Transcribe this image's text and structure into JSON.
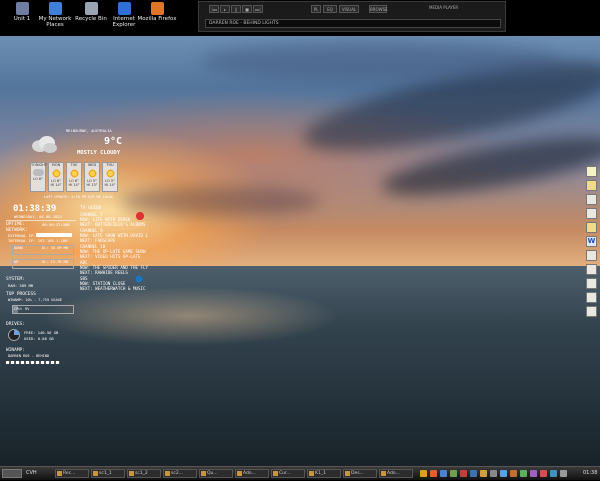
{
  "desktop_icons": [
    {
      "label": "Unit 1",
      "icon": "drive-icon",
      "color": "#6f7ea0"
    },
    {
      "label": "My Network Places",
      "icon": "network-places-icon",
      "color": "#3f7fd8"
    },
    {
      "label": "Recycle Bin",
      "icon": "recycle-bin-icon",
      "color": "#9aa4b2"
    },
    {
      "label": "Internet Explorer",
      "icon": "internet-explorer-icon",
      "color": "#2f6fd8"
    },
    {
      "label": "Mozilla Firefox",
      "icon": "firefox-icon",
      "color": "#e0752a"
    }
  ],
  "media_player": {
    "now_playing": "DARREN ROE - BEHIND LIGHTS",
    "buttons": [
      "|◂◂",
      "▸",
      "||",
      "■",
      "▸▸|",
      "PL",
      "EQ",
      "VISUAL",
      "BROWSE"
    ],
    "mode": "MEDIA PLAYER"
  },
  "weather": {
    "location": "MELBOURNE, AUSTRALIA",
    "temperature": "9°C",
    "condition": "MOSTLY CLOUDY",
    "updated": "LAST UPDATE: 5:59 PM   USE ME LOCAL",
    "forecast": [
      {
        "day": "TONIGHT",
        "low": "LO 8°",
        "high": "",
        "icon": "cloud-icon"
      },
      {
        "day": "MON",
        "low": "LO 6°",
        "high": "HI 14°",
        "icon": "sun-icon"
      },
      {
        "day": "TUE",
        "low": "LO 6°",
        "high": "HI 14°",
        "icon": "sun-icon"
      },
      {
        "day": "WED",
        "low": "LO 5°",
        "high": "HI 13°",
        "icon": "sun-icon"
      },
      {
        "day": "THU",
        "low": "LO 5°",
        "high": "HI 14°",
        "icon": "sun-icon"
      }
    ]
  },
  "system": {
    "clock": "01:38:39",
    "date": "WEDNESDAY, 04.08.2021",
    "uptime_label": "UPTIME:",
    "uptime": "00:5H:17:40M",
    "network_label": "NETWORK:",
    "ext_ip": "EXTERNAL IP:",
    "int_ip": "INTERNAL IP: 192.168.1.100",
    "down": "DOWN",
    "down_total": "DL: 38.5M MB",
    "up": "UP",
    "up_total": "UL: 15.7M MB",
    "sys_label": "SYSTEM:",
    "ram": "RAM: 389 MB",
    "top_process": "TOP PROCESS",
    "winamp": "WINAMP: 10% - 7,755 USAGE",
    "cpu": "CPU: 9%",
    "drives_label": "DRIVES:",
    "free": "FREE: 140.56 GB",
    "used": "USED: 0.86 GB",
    "winamp_label": "WINAMP:",
    "track": "DARREN ROE - BEHIND",
    "cpu_fill": 0.09
  },
  "tv_guide": {
    "title": "TV GUIDE",
    "lines": [
      "CHANNEL 7",
      "NOW: LIFE WITH DEREK",
      "NEXT: BUTTERFIELD'S ALBUMS",
      "CHANNEL 9",
      "NOW: LATE SHOW WITH DAVID L",
      "NEXT: FARSCAPE",
      "CHANNEL 10",
      "NOW: THE UP-LATE GAME SHOW",
      "NEXT: VIDEO HITS UP-LATE",
      "ABC",
      "NOW: THE SPIDER AND THE FLY",
      "NEXT: RAWHIDE REELS",
      "SBS",
      "NOW: STATION CLOSE",
      "NEXT: WEATHERWATCH & MUSIC"
    ]
  },
  "taskbar": {
    "start": "CVH",
    "buttons": [
      "Rec...",
      "sc1_1",
      "sc1_2",
      "sc2...",
      "Qu...",
      "Ado...",
      "Cur...",
      "K1_1",
      "Des...",
      "Ado..."
    ],
    "clock": "01:38",
    "accent": "#c89640"
  },
  "right_dock": [
    "notes-icon",
    "folder-icon",
    "document-icon",
    "document-icon",
    "folder-icon",
    "word-icon",
    "document-icon",
    "document-icon",
    "document-icon",
    "document-icon",
    "document-icon"
  ]
}
